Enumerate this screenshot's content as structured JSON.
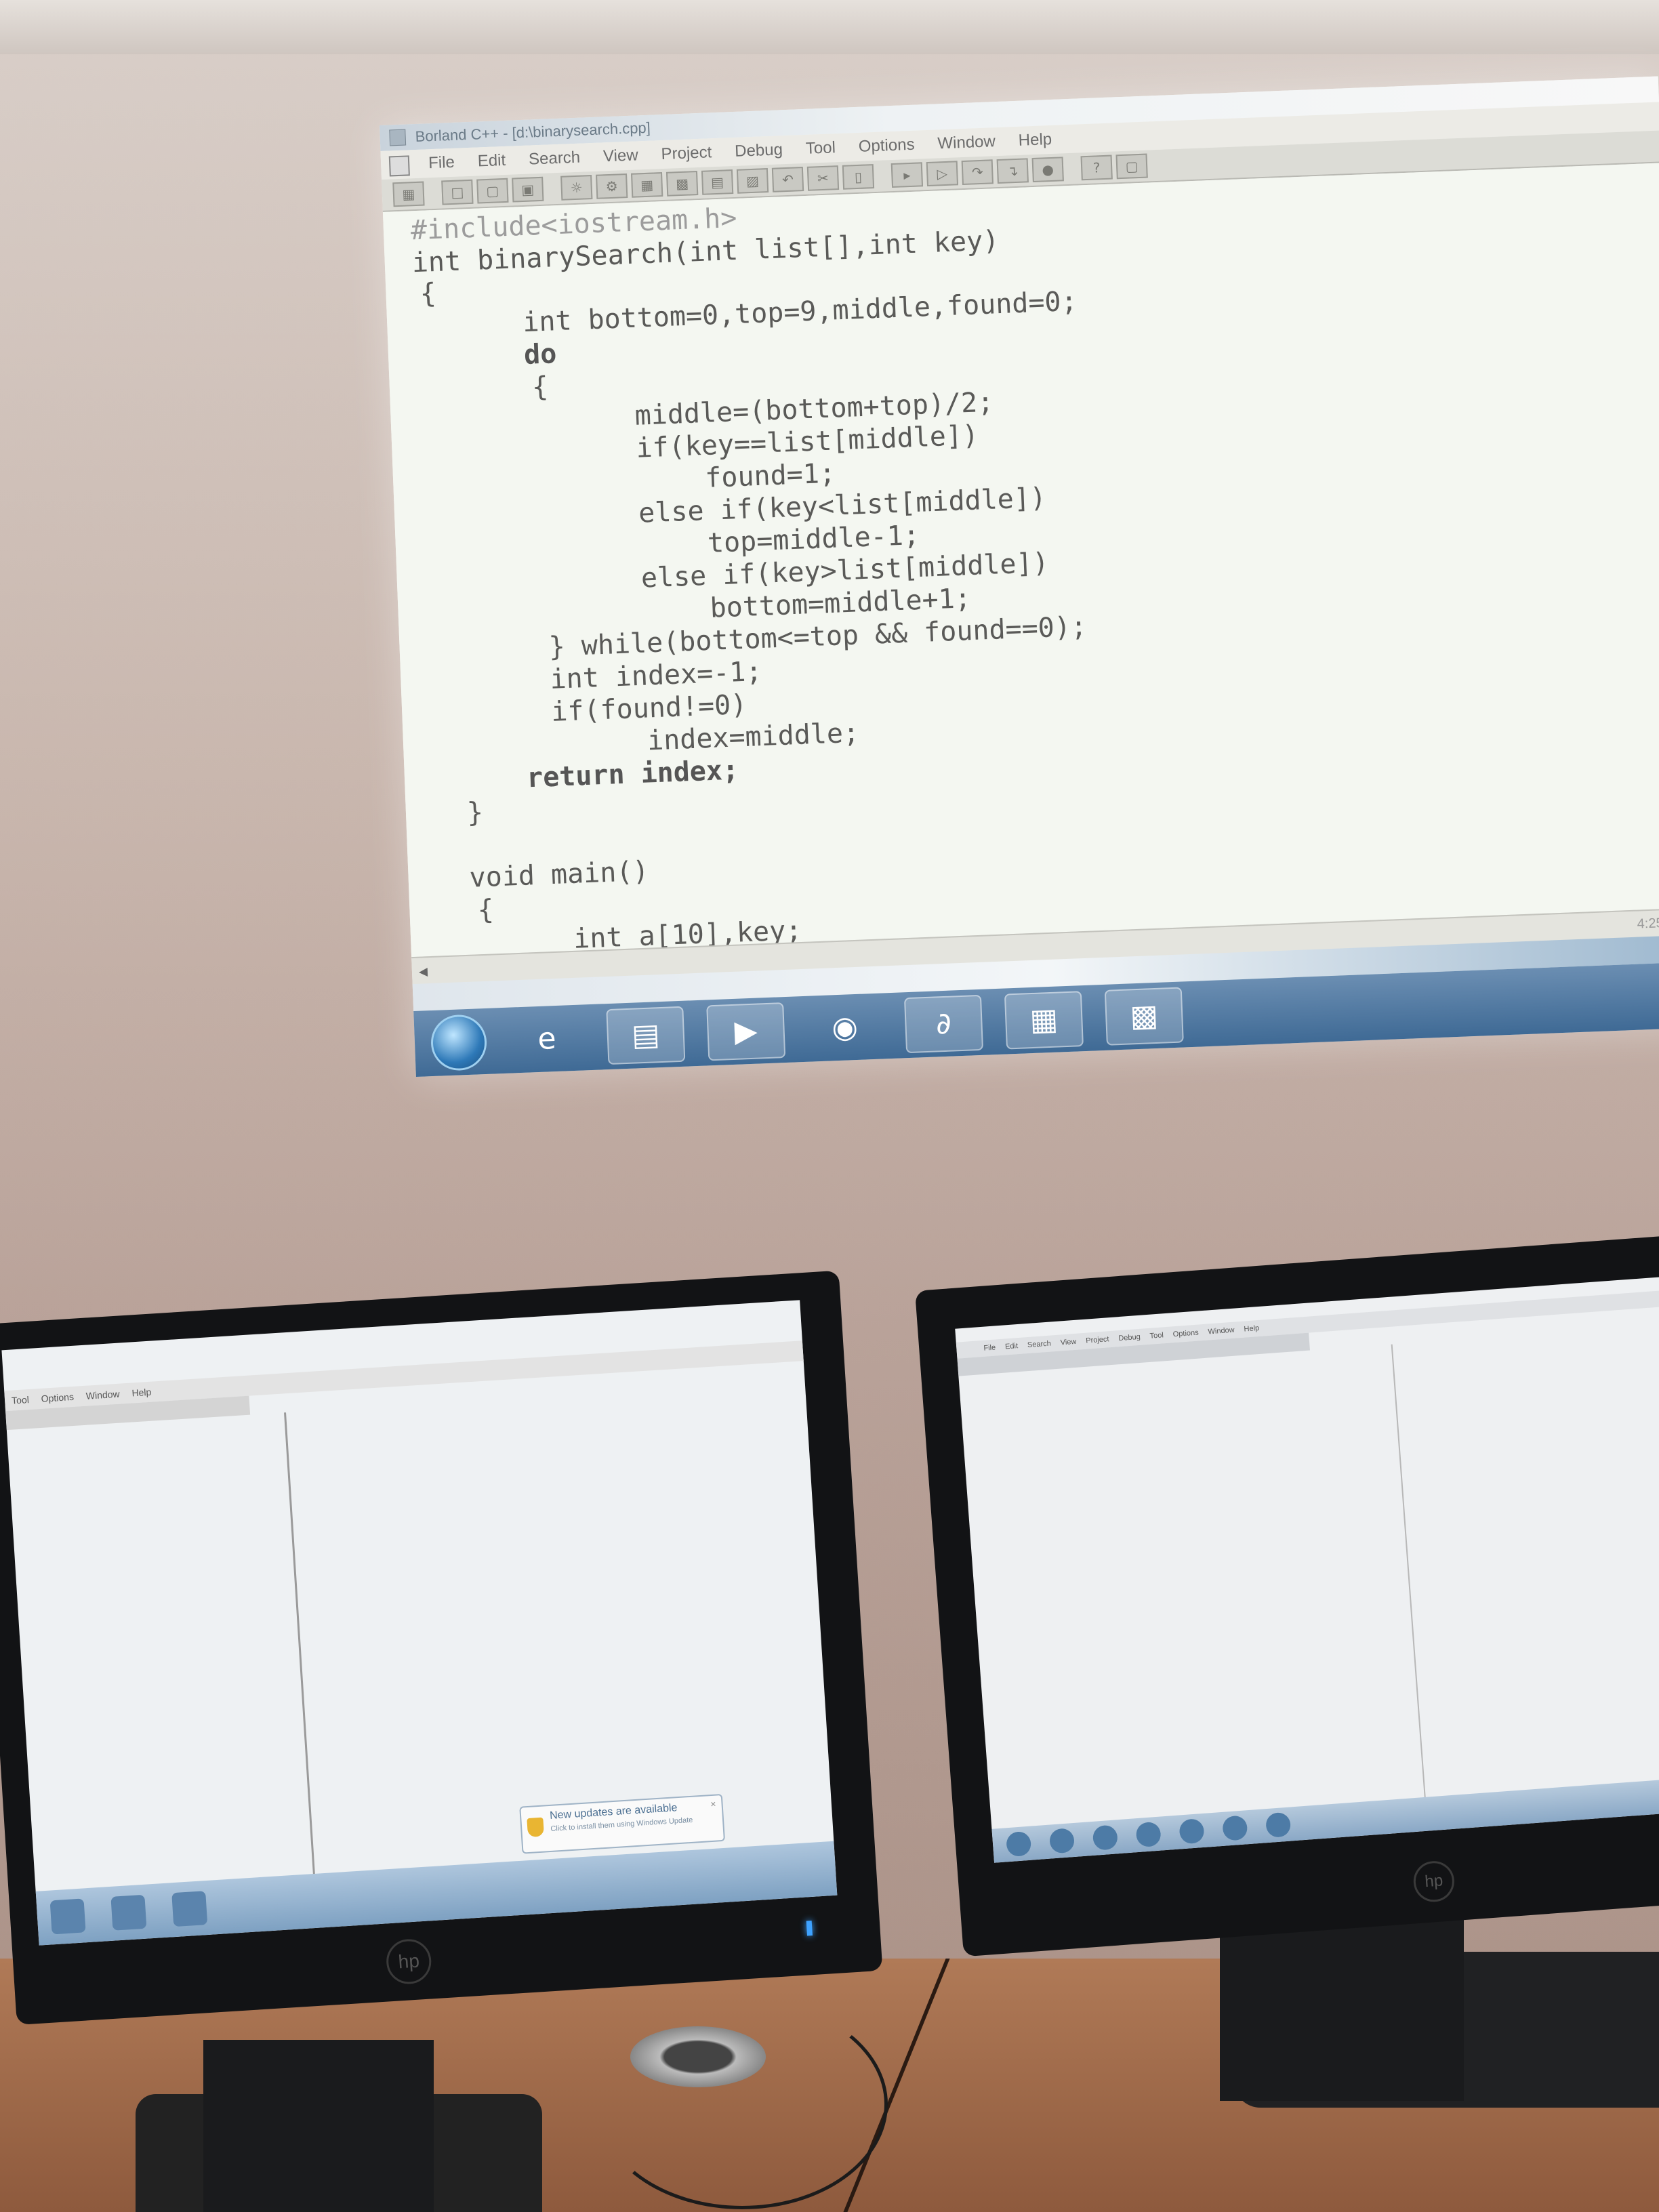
{
  "projection": {
    "title": "Borland C++ - [d:\\binarysearch.cpp]",
    "menu": [
      "File",
      "Edit",
      "Search",
      "View",
      "Project",
      "Debug",
      "Tool",
      "Options",
      "Window",
      "Help"
    ],
    "code": [
      {
        "text": "#include<iostream.h>"
      },
      {
        "text": "int binarySearch(int list[],int key)"
      },
      {
        "text": "{"
      },
      {
        "text": "int bottom=0,top=9,middle,found=0;"
      },
      {
        "text": "do"
      },
      {
        "text": "{"
      },
      {
        "text": "middle=(bottom+top)/2;"
      },
      {
        "text": "if(key==list[middle])"
      },
      {
        "text": "found=1;"
      },
      {
        "text": "else if(key<list[middle])"
      },
      {
        "text": "top=middle-1;"
      },
      {
        "text": "else if(key>list[middle])"
      },
      {
        "text": "bottom=middle+1;"
      },
      {
        "text": "} while(bottom<=top && found==0);"
      },
      {
        "text": "int index=-1;"
      },
      {
        "text": "if(found!=0)"
      },
      {
        "text": "index=middle;"
      },
      {
        "text": "return index;"
      },
      {
        "text": "}"
      },
      {
        "text": "void main()"
      },
      {
        "text": "{"
      },
      {
        "text": "int a[10],key;"
      }
    ],
    "status_position": "4:25",
    "taskbar_icons": [
      "start-orb-icon",
      "internet-explorer-icon",
      "folder-icon",
      "media-player-icon",
      "chrome-icon",
      "math-app-icon",
      "calculator-icon",
      "borland-icon"
    ]
  },
  "left_monitor": {
    "menu": [
      "Tool",
      "Options",
      "Window",
      "Help"
    ],
    "notification": {
      "title": "New updates are available",
      "subtitle": "Click to install them using Windows Update"
    },
    "brand": "hp"
  },
  "right_monitor": {
    "menu": [
      "File",
      "Edit",
      "Search",
      "View",
      "Project",
      "Debug",
      "Tool",
      "Options",
      "Window",
      "Help"
    ],
    "brand": "hp"
  }
}
